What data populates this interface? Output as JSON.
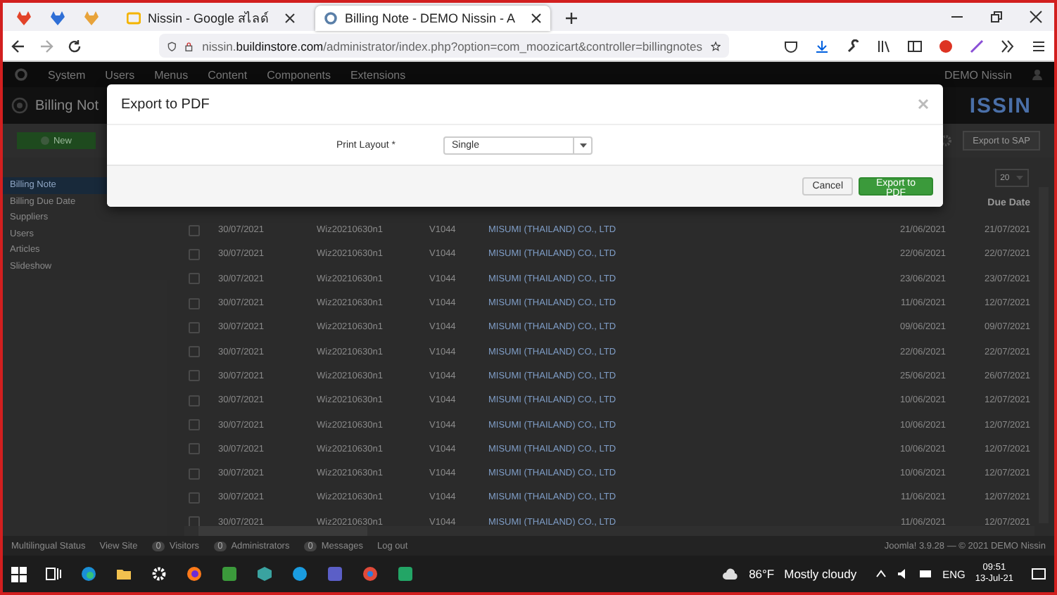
{
  "browser": {
    "tabs": [
      {
        "label": "Nissin - Google สไลด์",
        "selected": false
      },
      {
        "label": "Billing Note - DEMO Nissin - A",
        "selected": true
      }
    ],
    "url": "nissin.**buildinstore.com**/administrator/index.php?option=com_moozicart&controller=billingnotes"
  },
  "admin_menu": {
    "items": [
      "System",
      "Users",
      "Menus",
      "Content",
      "Components",
      "Extensions"
    ],
    "user": "DEMO Nissin"
  },
  "page": {
    "title": "Billing Not",
    "logo": "ISSIN"
  },
  "toolbar": {
    "new_button": "New",
    "export_sap_button": "Export to SAP"
  },
  "sidebar": {
    "items": [
      {
        "label": "Billing Note",
        "selected": true
      },
      {
        "label": "Billing Due Date",
        "selected": false
      },
      {
        "label": "Suppliers",
        "selected": false
      },
      {
        "label": "Users",
        "selected": false
      },
      {
        "label": "Articles",
        "selected": false
      },
      {
        "label": "Slideshow",
        "selected": false
      }
    ]
  },
  "list": {
    "limit": "20",
    "due_date_header": "Due Date",
    "rows": [
      {
        "checked": false,
        "cells": [
          "30/07/2021",
          "Wiz20210630n1",
          "V1044",
          "MISUMI (THAILAND) CO., LTD",
          "21/06/2021",
          "21/07/2021"
        ]
      },
      {
        "checked": false,
        "cells": [
          "30/07/2021",
          "Wiz20210630n1",
          "V1044",
          "MISUMI (THAILAND) CO., LTD",
          "22/06/2021",
          "22/07/2021"
        ]
      },
      {
        "checked": false,
        "cells": [
          "30/07/2021",
          "Wiz20210630n1",
          "V1044",
          "MISUMI (THAILAND) CO., LTD",
          "23/06/2021",
          "23/07/2021"
        ]
      },
      {
        "checked": false,
        "cells": [
          "30/07/2021",
          "Wiz20210630n1",
          "V1044",
          "MISUMI (THAILAND) CO., LTD",
          "11/06/2021",
          "12/07/2021"
        ]
      },
      {
        "checked": false,
        "cells": [
          "30/07/2021",
          "Wiz20210630n1",
          "V1044",
          "MISUMI (THAILAND) CO., LTD",
          "09/06/2021",
          "09/07/2021"
        ]
      },
      {
        "checked": false,
        "cells": [
          "30/07/2021",
          "Wiz20210630n1",
          "V1044",
          "MISUMI (THAILAND) CO., LTD",
          "22/06/2021",
          "22/07/2021"
        ]
      },
      {
        "checked": false,
        "cells": [
          "30/07/2021",
          "Wiz20210630n1",
          "V1044",
          "MISUMI (THAILAND) CO., LTD",
          "25/06/2021",
          "26/07/2021"
        ]
      },
      {
        "checked": false,
        "cells": [
          "30/07/2021",
          "Wiz20210630n1",
          "V1044",
          "MISUMI (THAILAND) CO., LTD",
          "10/06/2021",
          "12/07/2021"
        ]
      },
      {
        "checked": false,
        "cells": [
          "30/07/2021",
          "Wiz20210630n1",
          "V1044",
          "MISUMI (THAILAND) CO., LTD",
          "10/06/2021",
          "12/07/2021"
        ]
      },
      {
        "checked": false,
        "cells": [
          "30/07/2021",
          "Wiz20210630n1",
          "V1044",
          "MISUMI (THAILAND) CO., LTD",
          "10/06/2021",
          "12/07/2021"
        ]
      },
      {
        "checked": false,
        "cells": [
          "30/07/2021",
          "Wiz20210630n1",
          "V1044",
          "MISUMI (THAILAND) CO., LTD",
          "10/06/2021",
          "12/07/2021"
        ]
      },
      {
        "checked": false,
        "cells": [
          "30/07/2021",
          "Wiz20210630n1",
          "V1044",
          "MISUMI (THAILAND) CO., LTD",
          "11/06/2021",
          "12/07/2021"
        ]
      },
      {
        "checked": false,
        "cells": [
          "30/07/2021",
          "Wiz20210630n1",
          "V1044",
          "MISUMI (THAILAND) CO., LTD",
          "11/06/2021",
          "12/07/2021"
        ]
      }
    ]
  },
  "modal": {
    "title": "Export to PDF",
    "field_label": "Print Layout *",
    "field_value": "Single",
    "cancel_button": "Cancel",
    "submit_button": "Export to PDF"
  },
  "status_bar": {
    "items": [
      {
        "kind": "link",
        "label": "Multilingual Status"
      },
      {
        "kind": "link",
        "label": "View Site"
      },
      {
        "kind": "count",
        "badge": "0",
        "label": "Visitors"
      },
      {
        "kind": "count",
        "badge": "0",
        "label": "Administrators"
      },
      {
        "kind": "count",
        "badge": "0",
        "label": "Messages"
      },
      {
        "kind": "link",
        "label": "Log out"
      }
    ],
    "version": "Joomla! 3.9.28 — © 2021 DEMO Nissin"
  },
  "taskbar": {
    "temperature": "86°F",
    "condition": "Mostly cloudy",
    "language": "ENG",
    "time": "09:51",
    "date": "13-Jul-21"
  }
}
